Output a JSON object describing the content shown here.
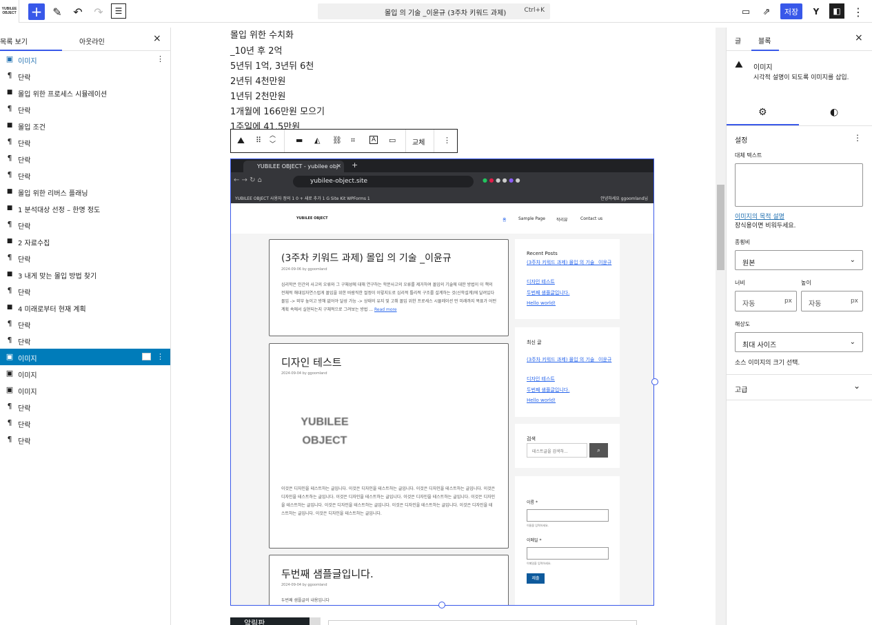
{
  "topbar": {
    "logo_text": "YUBILEE OBJECT",
    "command_title": "몰입 의 기술 _이윤규 (3주차 키워드 과제)",
    "command_shortcut": "Ctrl+K",
    "save_label": "저장"
  },
  "left_panel": {
    "tab_list": "목록 보기",
    "tab_outline": "아웃라인",
    "items": [
      {
        "label": "이미지",
        "icon": "image-icon"
      },
      {
        "label": "단락",
        "icon": "paragraph-icon"
      },
      {
        "label": "몰입 위한 프로세스 시뮬레이션",
        "icon": "heading-icon"
      },
      {
        "label": "단락",
        "icon": "paragraph-icon"
      },
      {
        "label": "몰입 조건",
        "icon": "heading-icon"
      },
      {
        "label": "단락",
        "icon": "paragraph-icon"
      },
      {
        "label": "단락",
        "icon": "paragraph-icon"
      },
      {
        "label": "단락",
        "icon": "paragraph-icon"
      },
      {
        "label": "몰입 위한 리버스 플래닝",
        "icon": "heading-icon"
      },
      {
        "label": "1 분석대상 선정 – 한명 정도",
        "icon": "heading-icon"
      },
      {
        "label": "단락",
        "icon": "paragraph-icon"
      },
      {
        "label": "2 자료수집",
        "icon": "heading-icon"
      },
      {
        "label": "단락",
        "icon": "paragraph-icon"
      },
      {
        "label": "3 내게 맞는 몰입 방법 찾기",
        "icon": "heading-icon"
      },
      {
        "label": "단락",
        "icon": "paragraph-icon"
      },
      {
        "label": "4 미래로부터 현재 계획",
        "icon": "heading-icon"
      },
      {
        "label": "단락",
        "icon": "paragraph-icon"
      },
      {
        "label": "단락",
        "icon": "paragraph-icon"
      },
      {
        "label": "이미지",
        "icon": "image-icon",
        "selected": true
      },
      {
        "label": "이미지",
        "icon": "image-icon"
      },
      {
        "label": "이미지",
        "icon": "image-icon"
      },
      {
        "label": "단락",
        "icon": "paragraph-icon"
      },
      {
        "label": "단락",
        "icon": "paragraph-icon"
      },
      {
        "label": "단락",
        "icon": "paragraph-icon"
      }
    ]
  },
  "content": {
    "paragraphs": [
      "몰입 위한 수치화",
      "_10년 후 2억",
      "5년뒤 1억, 3년뒤 6천",
      "2년뒤 4천만원",
      "1년뒤 2천만원",
      "1개월에 166만원 모으기",
      "1주일에 41.5만원"
    ],
    "toolbar_replace": "교체",
    "bottom_label": "알림판"
  },
  "screenshot": {
    "tab_title": "YUBILEE OBJECT - yubilee obj",
    "url": "yubilee-object.site",
    "bookmarks": "YUBILEE OBJECT   사용자 정의   1   0   + 새로 추가   1   G Site Kit   WPForms 1",
    "greeting": "안녕하세요 ggoomland님",
    "site_title": "YUBILEE OBJECT",
    "nav": [
      "홈",
      "Sample Page",
      "작리뷰",
      "Contact us"
    ],
    "posts": [
      {
        "title": "(3주차 키워드 과제) 몰입 의 기술 _이윤규",
        "meta": "2024-09-06 by ggoomland",
        "excerpt": "심리학은 인간의 사고의 오류와 그 구체성에 대해 연구하는 학문사고의 오류를 제거하여 몰입의 기술에 대한 방법이 이 책의 전체적 해대입자연스럽게 몰입을 위한 바람직한 절정이 이렇지도로 심리적 틀리적 구조를 설계하는 것(신학설계)에 달려있다몰입 -> 외부 높이고 방해 없어야 달성 가능 -> 상태의 유지 및 고취 몰입 위한 프로세스 시뮬레이션 먼 미래까지 목표가 어떤 계획 속에서 실현되는지 구체적으로 그려보는 방법 ...",
        "more": "Read more"
      },
      {
        "title": "디자인 테스트",
        "meta": "2024-09-04 by ggoomland",
        "logo": "YUBILEE OBJECT",
        "excerpt": "이것은 디자인을 테스트하는 글입니다. 이것은 디자인을 테스트하는 글입니다. 이것은 디자인을 테스트하는 글입니다. 이것은 디자인을 테스트하는 글입니다. 이것은 디자인을 테스트하는 글입니다. 이것은 디자인을 테스트하는 글입니다. 이것은 디자인을 테스트하는 글입니다. 이것은 디자인을 테스트하는 글입니다. 이것은 디자인을 테스트하는 글입니다. 이것은 디자인을 테스트하는 글입니다. 이것은 디자인을 테스트하는 글입니다."
      },
      {
        "title": "두번째 샘플글입니다.",
        "meta": "2024-09-04 by ggoomland",
        "excerpt": "두번째 샘플글의 내용입니다"
      }
    ],
    "recent_title": "Recent Posts",
    "recent_links": [
      "(3주차 키워드 과제) 몰입 의 기술 _이윤규",
      "디자인 테스트",
      "두번째 샘플글입니다.",
      "Hello world!"
    ],
    "recent_title_kr": "최신 글",
    "search_title": "검색",
    "search_placeholder": "테스트글을 검색하...",
    "form_name": "이름 *",
    "form_name_hint": "이름을 입력하세요.",
    "form_email": "이메일 *",
    "form_email_hint": "이메일을 입력하세요.",
    "form_submit": "제출"
  },
  "right_panel": {
    "tab_post": "글",
    "tab_block": "블록",
    "block_name": "이미지",
    "block_desc": "시각적 설명이 되도록 이미지를 삽입.",
    "settings_title": "설정",
    "alt_label": "대체 텍스트",
    "alt_link": "이미지의 목적 설명",
    "alt_help": "장식용이면 비워두세요.",
    "aspect_label": "종횡비",
    "aspect_value": "원본",
    "width_label": "너비",
    "height_label": "높이",
    "width_placeholder": "자동",
    "height_placeholder": "자동",
    "unit": "px",
    "resolution_label": "해상도",
    "resolution_value": "최대 사이즈",
    "resolution_help": "소스 이미지의 크기 선택.",
    "advanced_label": "고급"
  }
}
